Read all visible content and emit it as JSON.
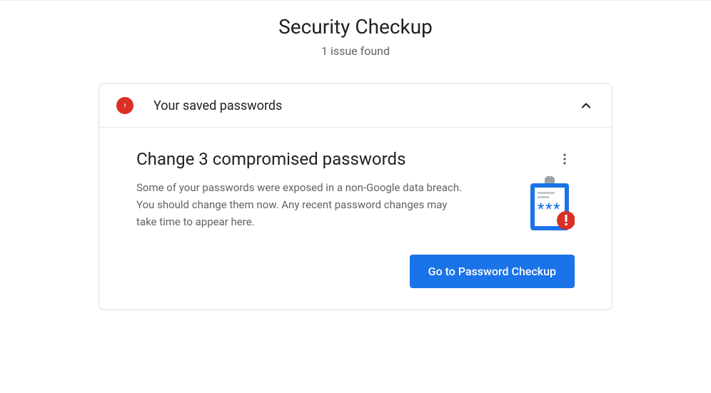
{
  "page": {
    "title": "Security Checkup",
    "subtitle": "1 issue found"
  },
  "card": {
    "header": {
      "title": "Your saved passwords",
      "status": "alert"
    },
    "body": {
      "title": "Change 3 compromised passwords",
      "description": "Some of your passwords were exposed in a non-Google data breach. You should change them now. Any recent password changes may take time to appear here.",
      "action_label": "Go to Password Checkup"
    }
  },
  "colors": {
    "alert": "#d93025",
    "primary": "#1a73e8"
  }
}
